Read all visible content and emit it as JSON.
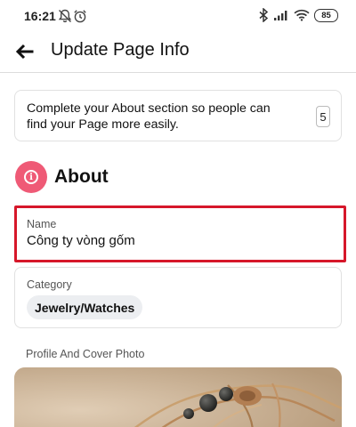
{
  "status_bar": {
    "time": "16:21",
    "left_icons": [
      "mute-bell-icon",
      "alarm-icon"
    ],
    "right_icons": [
      "bluetooth-icon",
      "signal-icon",
      "wifi-icon",
      "battery-icon"
    ],
    "battery_level": "85"
  },
  "app_bar": {
    "back_icon": "arrow-left-icon",
    "title": "Update Page Info"
  },
  "notice": {
    "text": "Complete your About section so people can find your Page more easily.",
    "count": "5"
  },
  "about": {
    "icon": "info-icon",
    "title": "About",
    "accent_color": "#ef5a76"
  },
  "name_field": {
    "label": "Name",
    "value": "Công ty vòng gốm",
    "highlight_color": "#d6172a"
  },
  "category_field": {
    "label": "Category",
    "value": "Jewelry/Watches"
  },
  "photo_section": {
    "label": "Profile And Cover Photo"
  }
}
